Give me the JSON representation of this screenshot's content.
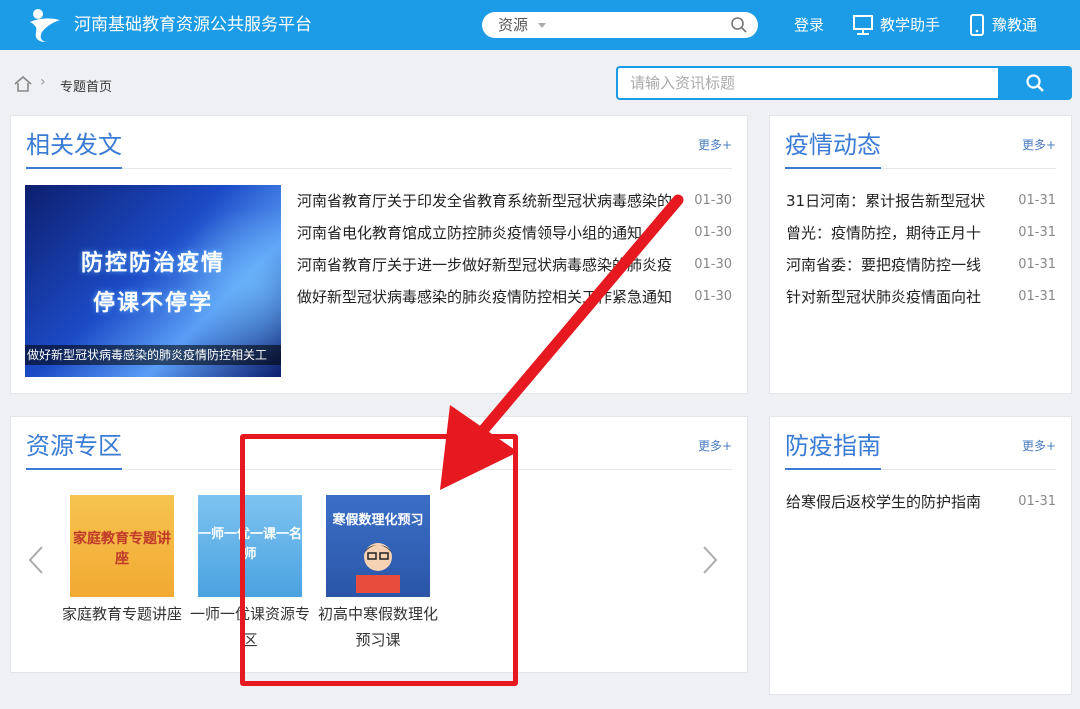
{
  "header": {
    "site_title": "河南基础教育资源公共服务平台",
    "search_category": "资源",
    "login": "登录",
    "assistant": "教学助手",
    "yujiaotong": "豫教通"
  },
  "breadcrumb": {
    "current": "专题首页"
  },
  "info_search": {
    "placeholder": "请输入资讯标题"
  },
  "more_label": "更多+",
  "panels": {
    "related": {
      "title": "相关发文",
      "feature_caption": "做好新型冠状病毒感染的肺炎疫情防控相关工",
      "feature_line1": "防控防治疫情",
      "feature_line2": "停课不停学",
      "items": [
        {
          "title": "河南省教育厅关于印发全省教育系统新型冠状病毒感染的",
          "date": "01-30"
        },
        {
          "title": "河南省电化教育馆成立防控肺炎疫情领导小组的通知",
          "date": "01-30"
        },
        {
          "title": "河南省教育厅关于进一步做好新型冠状病毒感染的肺炎疫",
          "date": "01-30"
        },
        {
          "title": "做好新型冠状病毒感染的肺炎疫情防控相关工作紧急通知",
          "date": "01-30"
        }
      ]
    },
    "epidemic": {
      "title": "疫情动态",
      "items": [
        {
          "title": "31日河南：累计报告新型冠状",
          "date": "01-31"
        },
        {
          "title": "曾光：疫情防控，期待正月十",
          "date": "01-31"
        },
        {
          "title": "河南省委：要把疫情防控一线",
          "date": "01-31"
        },
        {
          "title": "针对新型冠状肺炎疫情面向社",
          "date": "01-31"
        }
      ]
    },
    "resources": {
      "title": "资源专区",
      "tiles": [
        {
          "label": "家庭教育专题讲座",
          "thumb_text": "家庭教育专题讲座"
        },
        {
          "label": "一师一优课资源专区",
          "thumb_text": "一师一优一课一名师"
        },
        {
          "label": "初高中寒假数理化预习课",
          "thumb_text": "寒假数理化预习"
        }
      ]
    },
    "guide": {
      "title": "防疫指南",
      "items": [
        {
          "title": "给寒假后返校学生的防护指南",
          "date": "01-31"
        }
      ]
    }
  },
  "colors": {
    "brand": "#1c9be6",
    "title_blue": "#3a7bd5",
    "annotation_red": "#e5191f"
  }
}
